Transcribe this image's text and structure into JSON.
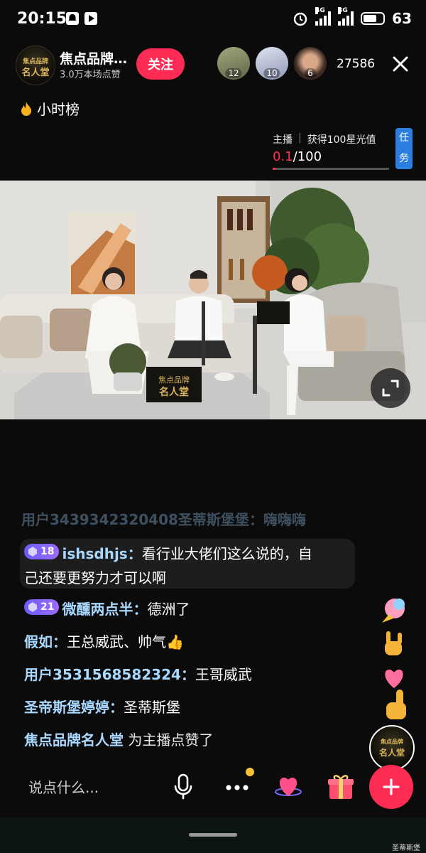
{
  "status_bar": {
    "time": "20:15",
    "signal_4g": "4G",
    "signal_3g": "3G",
    "battery": "63"
  },
  "header": {
    "room_title": "焦点品牌…",
    "likes": "3.0万本场点赞",
    "follow_label": "关注",
    "viewers": [
      {
        "badge": "12",
        "color": "#8b8f6a"
      },
      {
        "badge": "10",
        "color": "#b9c0d8"
      },
      {
        "badge": "6",
        "color": "#6e4e3a"
      }
    ],
    "viewer_count": "27586"
  },
  "logo": {
    "line1": "焦点品牌",
    "line2": "名人堂"
  },
  "rank": {
    "label": "小时榜"
  },
  "task": {
    "role": "主播",
    "goal": "获得100星光值",
    "current": "0.1",
    "total": "/100",
    "progress": 0.001,
    "button_line1": "任",
    "button_line2": "务"
  },
  "video": {
    "desk_sign_line1": "焦点品牌",
    "desk_sign_line2": "名人堂"
  },
  "chat": {
    "faded_line": "用户3439342320408圣蒂斯堡堡：嗨嗨嗨",
    "messages": [
      {
        "level": "18",
        "user": "ishsdhjs：",
        "text_line1": "看行业大佬们这么说的，自",
        "text_line2": "己还要更努力才可以啊"
      },
      {
        "level": "21",
        "user": "微醺两点半：",
        "text": "德洲了"
      },
      {
        "user": "假如：",
        "text": "王总威武、帅气👍"
      },
      {
        "user": "用户3531568582324：",
        "text": "王哥威武"
      },
      {
        "user": "圣帝斯堡婷婷：",
        "text": "圣蒂斯堡"
      },
      {
        "user": "焦点品牌名人堂",
        "text": " 为主播点赞了"
      }
    ]
  },
  "bottom": {
    "placeholder": "说点什么...",
    "watermark": "圣蒂斯堡"
  },
  "colors": {
    "accent": "#fe2c55",
    "username": "#a9d8ff",
    "task_button": "#2b7fe0"
  }
}
